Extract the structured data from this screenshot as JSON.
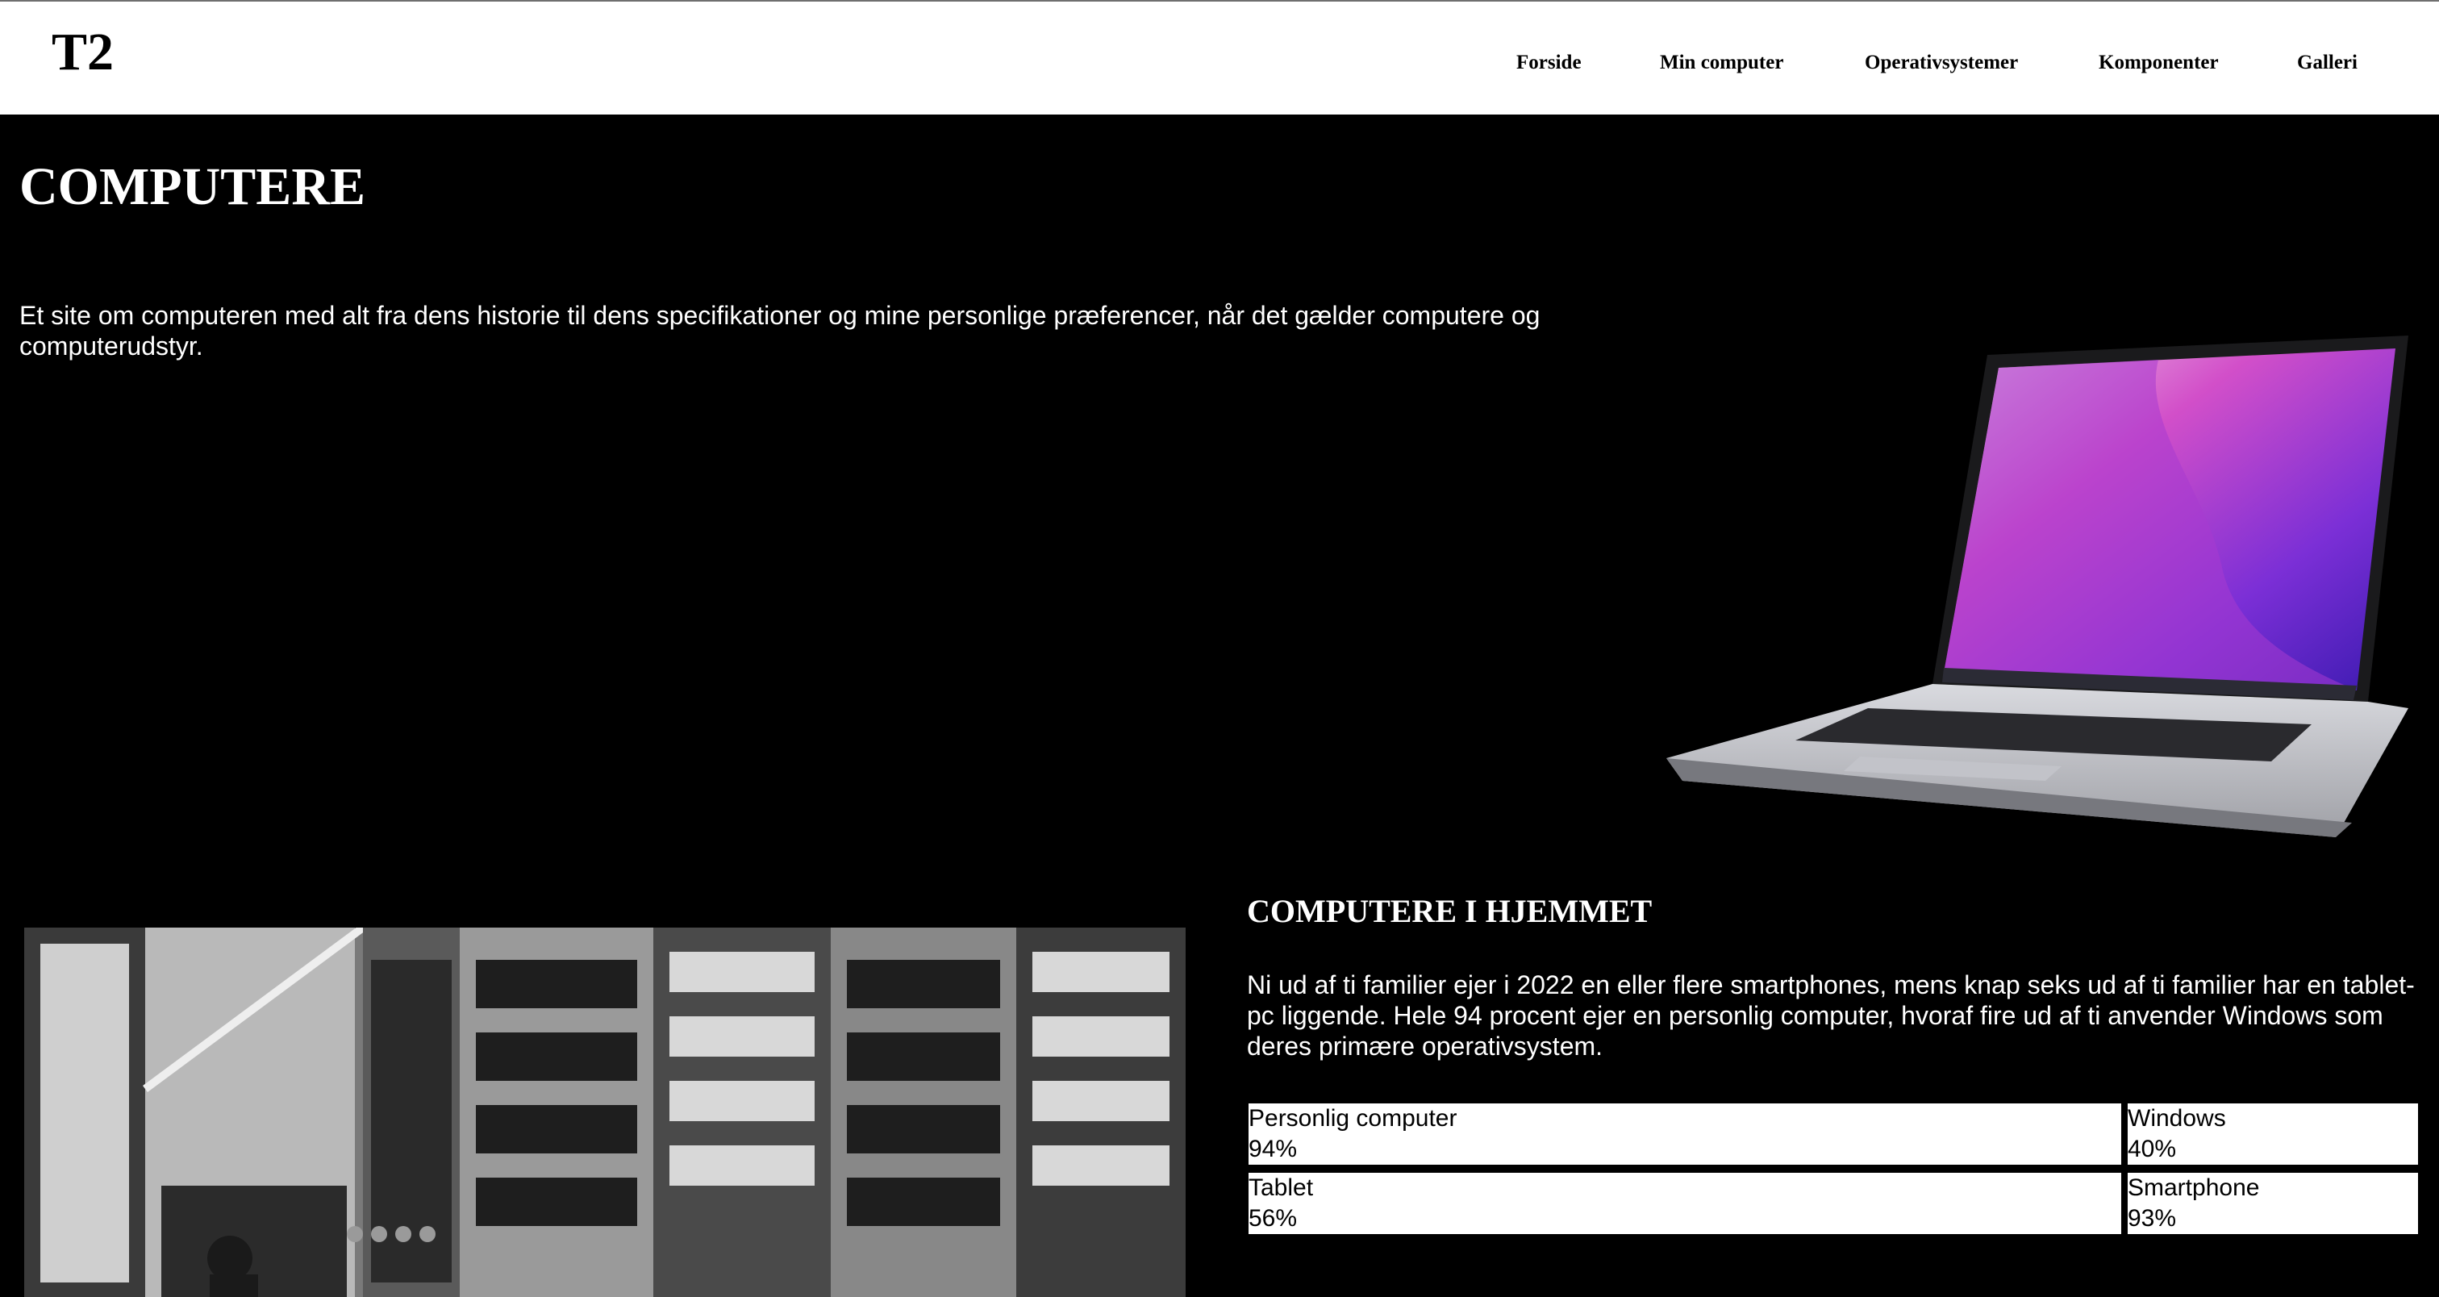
{
  "header": {
    "logo": "T2",
    "nav": [
      "Forside",
      "Min computer",
      "Operativsystemer",
      "Komponenter",
      "Galleri"
    ]
  },
  "hero": {
    "title": "COMPUTERE",
    "text": "Et site om computeren med alt fra dens historie til dens specifikationer og mine personlige præferencer, når det gælder computere og computerudstyr."
  },
  "section": {
    "title": "COMPUTERE I HJEMMET",
    "text": "Ni ud af ti familier ejer i 2022 en eller flere smartphones, mens knap seks ud af ti familier har en tablet-pc liggende. Hele 94 procent ejer en personlig computer, hvoraf fire ud af ti anvender Windows som deres primære operativsystem."
  },
  "stats": [
    {
      "label": "Personlig computer",
      "value": "94%"
    },
    {
      "label": "Windows",
      "value": "40%"
    },
    {
      "label": "Tablet",
      "value": "56%"
    },
    {
      "label": "Smartphone",
      "value": "93%"
    }
  ],
  "colors": {
    "background": "#000000",
    "header": "#ffffff",
    "text": "#ffffff",
    "accent": "#c93fcf"
  }
}
